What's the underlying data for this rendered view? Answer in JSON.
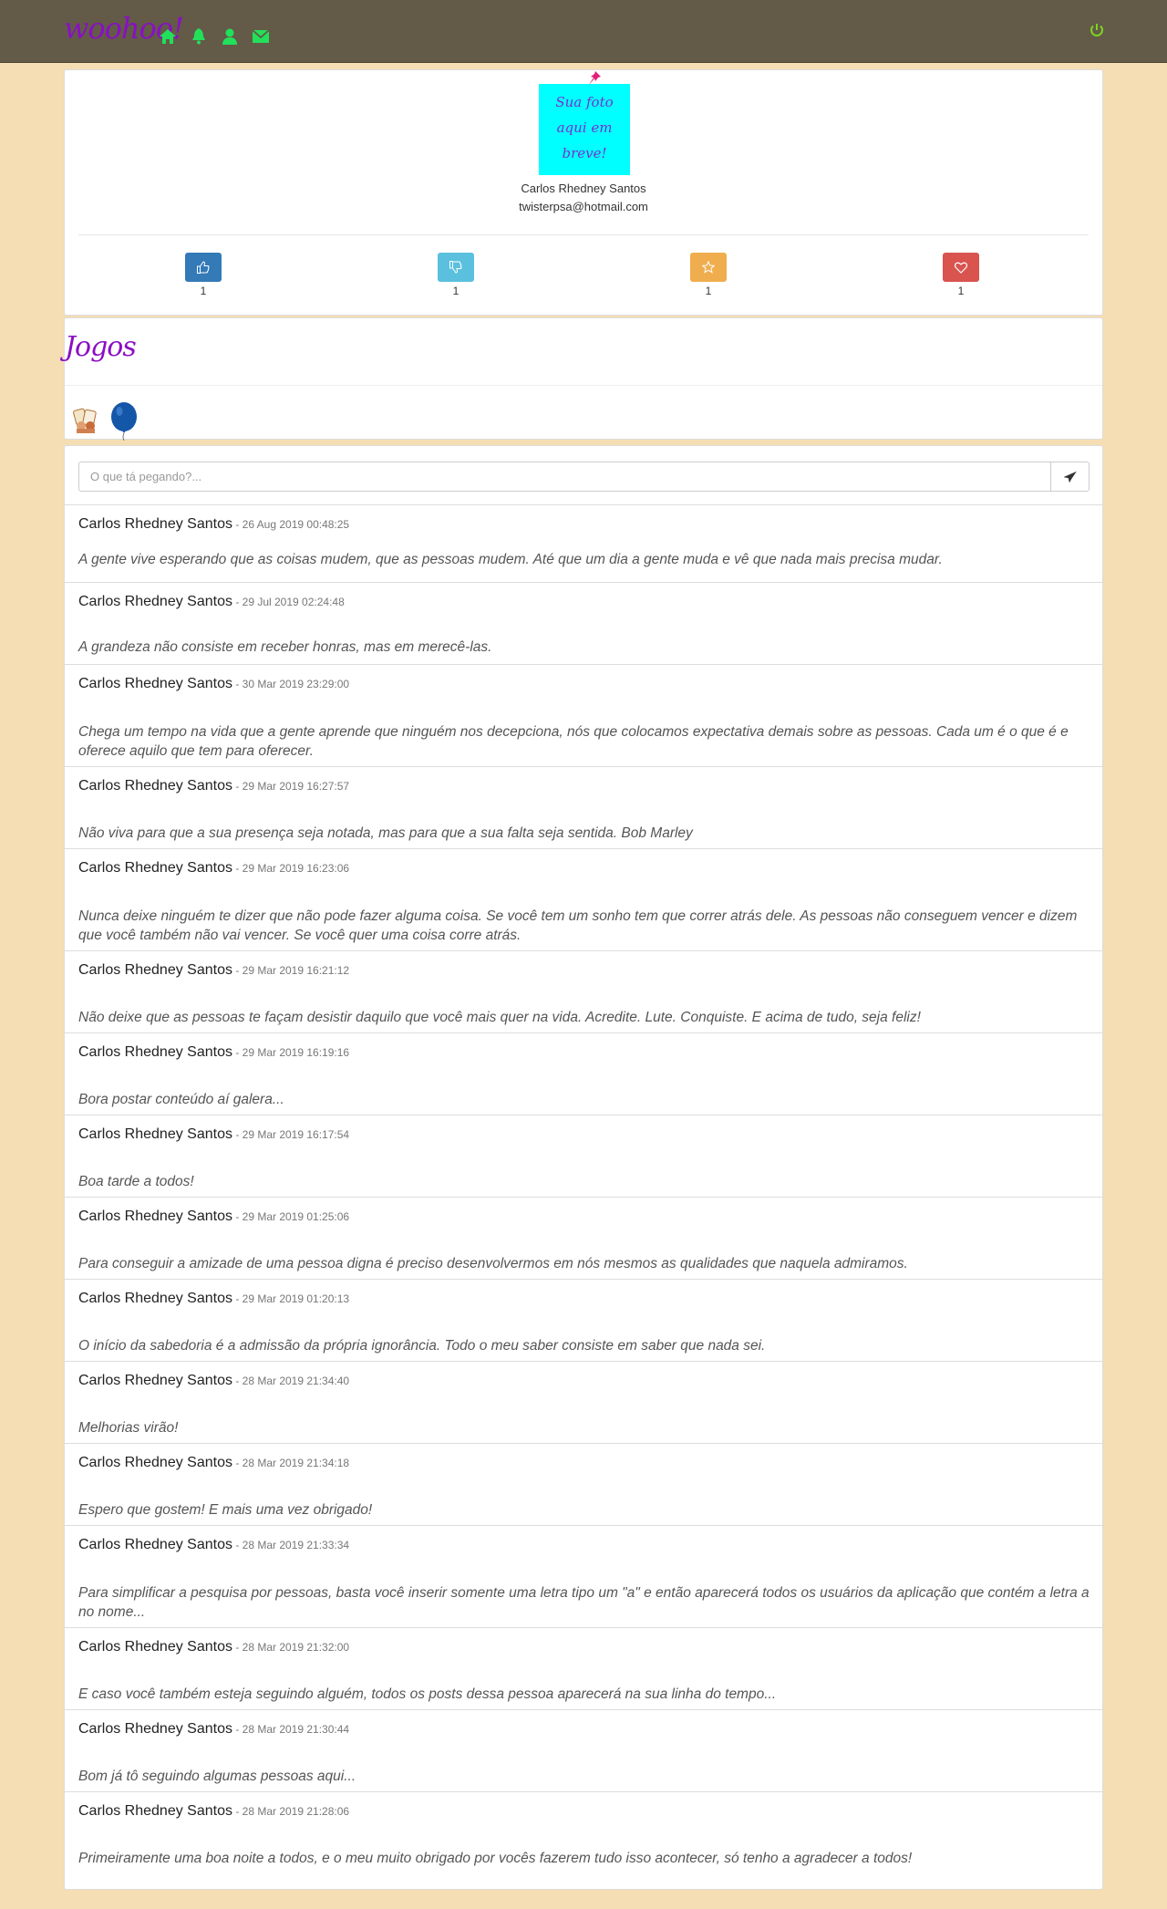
{
  "navbar": {
    "brand": "woohoo!",
    "icons": [
      "home-icon",
      "bell-icon",
      "user-icon",
      "envelope-icon"
    ],
    "right_icon": "power-icon"
  },
  "profile": {
    "photo_text": "Sua foto\naqui em\nbreve!",
    "name": "Carlos Rhedney Santos",
    "email": "twisterpsa@hotmail.com",
    "stats": [
      {
        "icon": "thumbs-up-icon",
        "count": "1",
        "color": "#337ab7"
      },
      {
        "icon": "thumbs-down-icon",
        "count": "1",
        "color": "#5bc0de"
      },
      {
        "icon": "star-icon",
        "count": "1",
        "color": "#f0ad4e"
      },
      {
        "icon": "heart-icon",
        "count": "1",
        "color": "#d9534f"
      }
    ]
  },
  "games": {
    "title": "Jogos",
    "items": [
      "cards-game-icon",
      "balloon-game-icon"
    ]
  },
  "feed": {
    "placeholder": "O que tá pegando?...",
    "send_icon": "send-icon",
    "posts": [
      {
        "author": "Carlos Rhedney Santos",
        "time": "26 Aug 2019 00:48:25",
        "text": "A gente vive esperando que as coisas mudem, que as pessoas mudem. Até que um dia a gente muda e vê que nada mais precisa mudar."
      },
      {
        "author": "Carlos Rhedney Santos",
        "time": "29 Jul 2019 02:24:48",
        "text": "A grandeza não consiste em receber honras, mas em merecê-las."
      },
      {
        "author": "Carlos Rhedney Santos",
        "time": "30 Mar 2019 23:29:00",
        "text": "Chega um tempo na vida que a gente aprende que ninguém nos decepciona, nós que colocamos expectativa demais sobre as pessoas. Cada um é o que é e oferece aquilo que tem para oferecer."
      },
      {
        "author": "Carlos Rhedney Santos",
        "time": "29 Mar 2019 16:27:57",
        "text": "Não viva para que a sua presença seja notada, mas para que a sua falta seja sentida. Bob Marley"
      },
      {
        "author": "Carlos Rhedney Santos",
        "time": "29 Mar 2019 16:23:06",
        "text": "Nunca deixe ninguém te dizer que não pode fazer alguma coisa. Se você tem um sonho tem que correr atrás dele. As pessoas não conseguem vencer e dizem que você também não vai vencer. Se você quer uma coisa corre atrás."
      },
      {
        "author": "Carlos Rhedney Santos",
        "time": "29 Mar 2019 16:21:12",
        "text": "Não deixe que as pessoas te façam desistir daquilo que você mais quer na vida. Acredite. Lute. Conquiste. E acima de tudo, seja feliz!"
      },
      {
        "author": "Carlos Rhedney Santos",
        "time": "29 Mar 2019 16:19:16",
        "text": "Bora postar conteúdo aí galera..."
      },
      {
        "author": "Carlos Rhedney Santos",
        "time": "29 Mar 2019 16:17:54",
        "text": "Boa tarde a todos!"
      },
      {
        "author": "Carlos Rhedney Santos",
        "time": "29 Mar 2019 01:25:06",
        "text": "Para conseguir a amizade de uma pessoa digna é preciso desenvolvermos em nós mesmos as qualidades que naquela admiramos."
      },
      {
        "author": "Carlos Rhedney Santos",
        "time": "29 Mar 2019 01:20:13",
        "text": "O início da sabedoria é a admissão da própria ignorância. Todo o meu saber consiste em saber que nada sei."
      },
      {
        "author": "Carlos Rhedney Santos",
        "time": "28 Mar 2019 21:34:40",
        "text": "Melhorias virão!"
      },
      {
        "author": "Carlos Rhedney Santos",
        "time": "28 Mar 2019 21:34:18",
        "text": "Espero que gostem! E mais uma vez obrigado!"
      },
      {
        "author": "Carlos Rhedney Santos",
        "time": "28 Mar 2019 21:33:34",
        "text": "Para simplificar a pesquisa por pessoas, basta você inserir somente uma letra tipo um \"a\" e então aparecerá todos os usuários da aplicação que contém a letra a no nome..."
      },
      {
        "author": "Carlos Rhedney Santos",
        "time": "28 Mar 2019 21:32:00",
        "text": "E caso você também esteja seguindo alguém, todos os posts dessa pessoa aparecerá na sua linha do tempo..."
      },
      {
        "author": "Carlos Rhedney Santos",
        "time": "28 Mar 2019 21:30:44",
        "text": "Bom já tô seguindo algumas pessoas aqui..."
      },
      {
        "author": "Carlos Rhedney Santos",
        "time": "28 Mar 2019 21:28:06",
        "text": "Primeiramente uma boa noite a todos, e o meu muito obrigado por vocês fazerem tudo isso acontecer, só tenho a agradecer a todos!"
      }
    ]
  }
}
